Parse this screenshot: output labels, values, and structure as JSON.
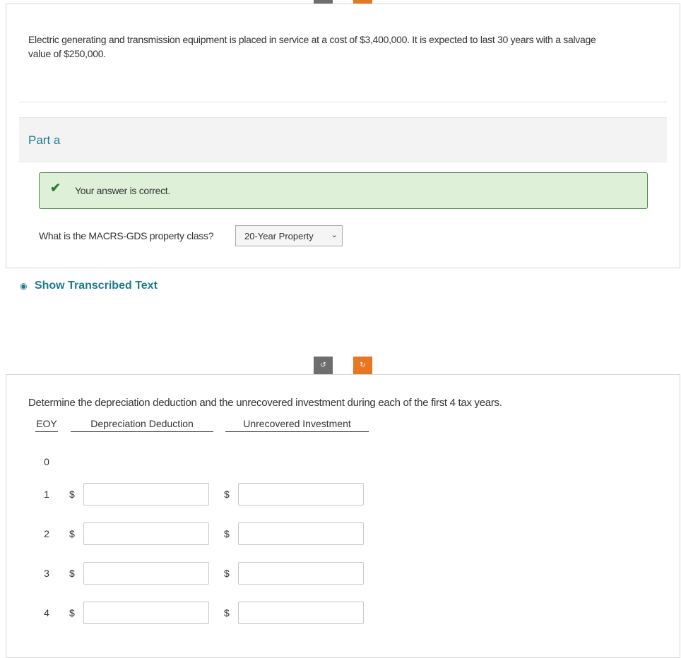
{
  "problem": {
    "text_line1": "Electric generating and transmission equipment is placed in service at a cost of $3,400,000. It is expected to last 30 years with a salvage",
    "text_line2": "value of $250,000."
  },
  "part_a": {
    "title": "Part a",
    "feedback": "Your answer is correct.",
    "question": "What is the MACRS-GDS property class?",
    "select_value": "20-Year Property"
  },
  "transcribed": {
    "label": "Show Transcribed Text"
  },
  "part_b": {
    "instruction": "Determine the depreciation deduction and the unrecovered investment during each of the first 4 tax years.",
    "headers": {
      "eoy": "EOY",
      "depreciation": "Depreciation Deduction",
      "unrecovered": "Unrecovered Investment"
    },
    "currency": "$",
    "rows": [
      {
        "eoy": "0"
      },
      {
        "eoy": "1",
        "depreciation": "",
        "unrecovered": ""
      },
      {
        "eoy": "2",
        "depreciation": "",
        "unrecovered": ""
      },
      {
        "eoy": "3",
        "depreciation": "",
        "unrecovered": ""
      },
      {
        "eoy": "4",
        "depreciation": "",
        "unrecovered": ""
      }
    ]
  },
  "colors": {
    "accent_teal": "#1b7a8c",
    "success_bg": "#dff0d8",
    "success_border": "#4d8a4d",
    "orange": "#e87722"
  }
}
